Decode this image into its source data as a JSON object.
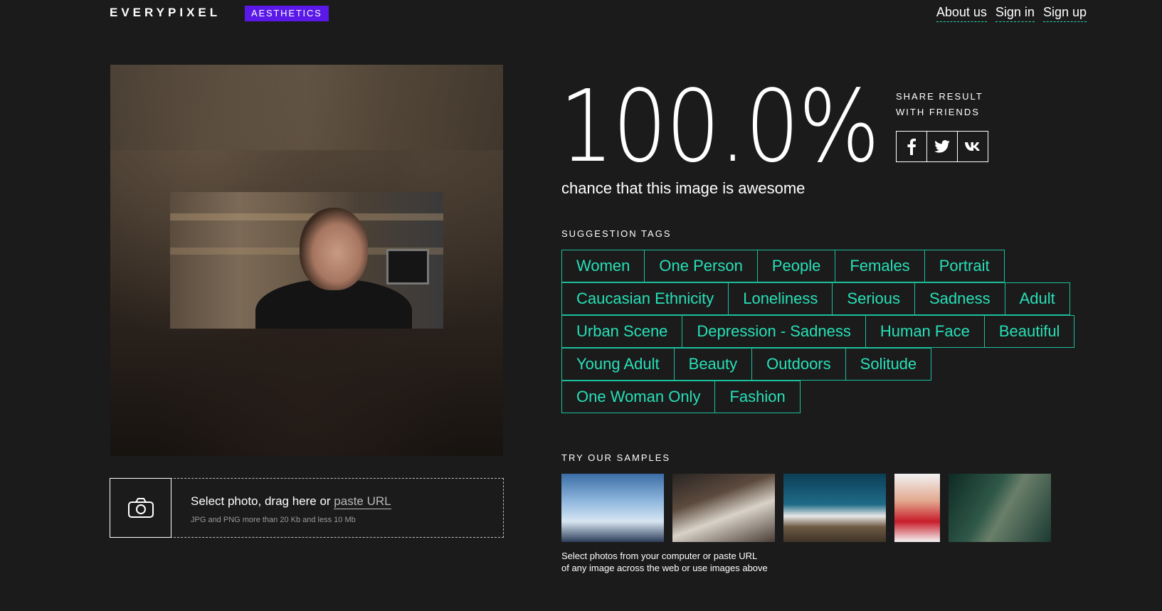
{
  "header": {
    "logo": "EVERYPIXEL",
    "badge": "AESTHETICS",
    "nav": [
      "About us",
      "Sign in",
      "Sign up"
    ]
  },
  "result": {
    "score": "100.0%",
    "caption": "chance that this image is awesome",
    "share_label_line1": "SHARE RESULT",
    "share_label_line2": "WITH FRIENDS",
    "share_buttons": [
      "f",
      "t",
      "vk"
    ]
  },
  "tags": {
    "title": "SUGGESTION TAGS",
    "items": [
      "Women",
      "One Person",
      "People",
      "Females",
      "Portrait",
      "Caucasian Ethnicity",
      "Loneliness",
      "Serious",
      "Sadness",
      "Adult",
      "Urban Scene",
      "Depression - Sadness",
      "Human Face",
      "Beautiful",
      "Young Adult",
      "Beauty",
      "Outdoors",
      "Solitude",
      "One Woman Only",
      "Fashion"
    ]
  },
  "upload": {
    "main_text": "Select photo, drag here or ",
    "url_text": "paste URL",
    "sub_text": "JPG and PNG more than 20 Kb and less 10 Mb",
    "icon": "camera-icon"
  },
  "samples": {
    "title": "TRY OUR SAMPLES",
    "note_line1": "Select photos from your computer or paste URL",
    "note_line2": "of any image across the web or use images above"
  },
  "colors": {
    "background": "#1b1b1b",
    "accent_badge": "#5a19e8",
    "tag_border": "#1bbf9c",
    "tag_text": "#27e0b8"
  }
}
